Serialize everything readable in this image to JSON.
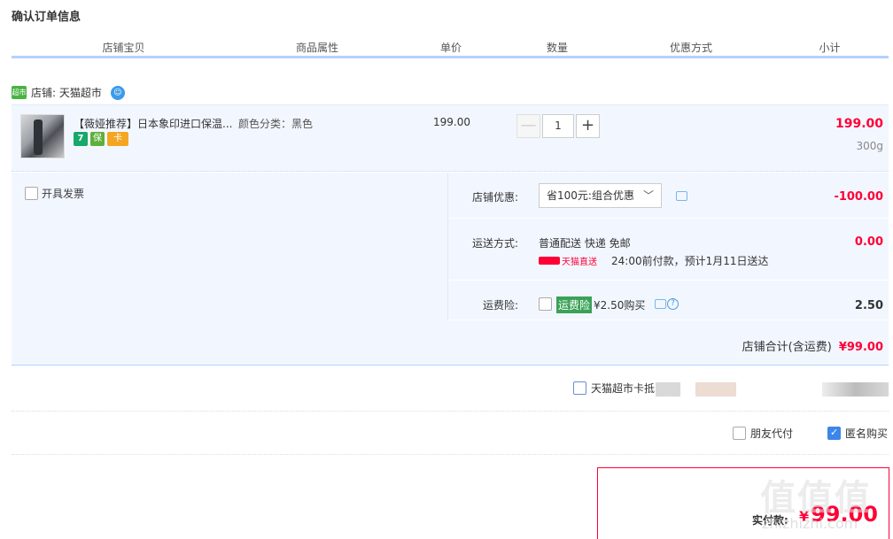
{
  "page_title": "确认订单信息",
  "columns": [
    "店铺宝贝",
    "商品属性",
    "单价",
    "数量",
    "优惠方式",
    "小计"
  ],
  "shop": {
    "logo_text": "超市",
    "label": "店铺: 天猫超市"
  },
  "item": {
    "title": "【薇娅推荐】日本象印进口保温...",
    "badges": [
      "7",
      "保",
      "卡"
    ],
    "attribute": "颜色分类：黑色",
    "price": "199.00",
    "quantity": "1",
    "minus": "—",
    "plus": "+",
    "subtotal": "199.00",
    "weight": "300g"
  },
  "invoice_label": "开具发票",
  "store_discount": {
    "label": "店铺优惠:",
    "selected": "省100元:组合优惠",
    "amount": "-100.00"
  },
  "shipping": {
    "label": "运送方式:",
    "method": "普通配送 快递 免邮",
    "direct_label": "天猫直送",
    "eta": "24:00前付款，预计1月11日送达",
    "amount": "0.00"
  },
  "insurance": {
    "label": "运费险:",
    "tag": "运费险",
    "price_text": "¥2.50购买",
    "amount": "2.50"
  },
  "shop_total": {
    "label": "店铺合计(含运费)",
    "amount": "¥99.00"
  },
  "card_payment": {
    "label": "天猫超市卡抵"
  },
  "friend_pay": {
    "label": "朋友代付"
  },
  "anonymous": {
    "label": "匿名购买"
  },
  "summary": {
    "pay_label": "实付款:",
    "currency": "¥",
    "amount": "99.00"
  },
  "watermark": {
    "main": "值值值",
    "sub": "zhizhizhi.com"
  },
  "colors": {
    "accent_red": "#ff0036",
    "header_blue": "#b2d1ff",
    "row_bg": "#f2f7ff"
  }
}
